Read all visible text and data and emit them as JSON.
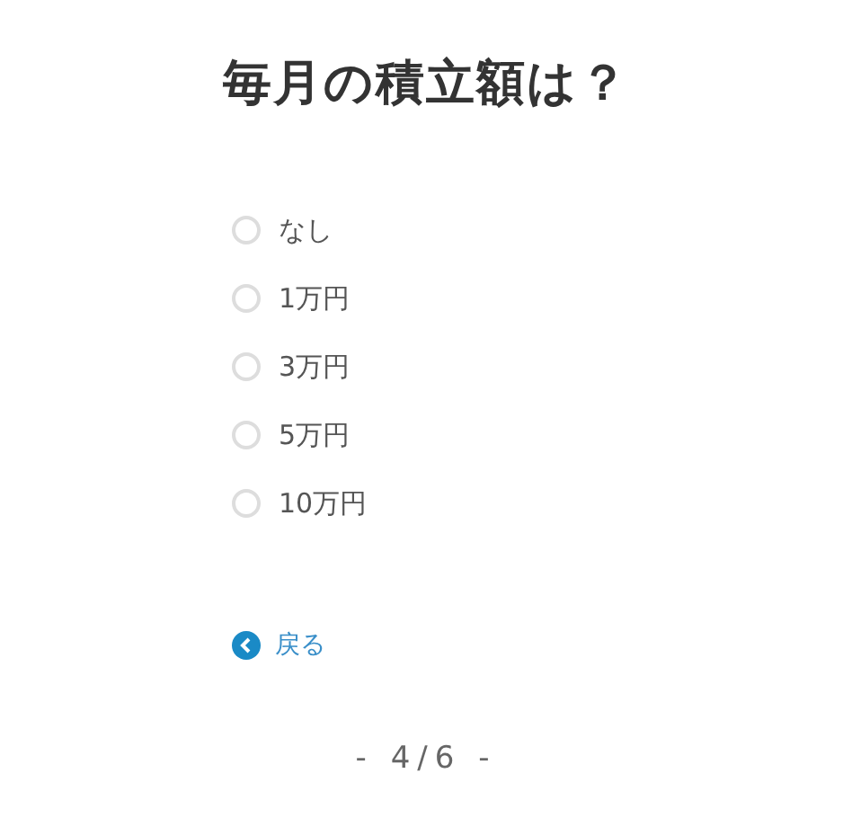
{
  "question": "毎月の積立額は？",
  "options": [
    {
      "label": "なし",
      "selected": false
    },
    {
      "label": "1万円",
      "selected": false
    },
    {
      "label": "3万円",
      "selected": false
    },
    {
      "label": "5万円",
      "selected": false
    },
    {
      "label": "10万円",
      "selected": false
    }
  ],
  "back": {
    "label": "戻る"
  },
  "progress": "- 4/6 -"
}
